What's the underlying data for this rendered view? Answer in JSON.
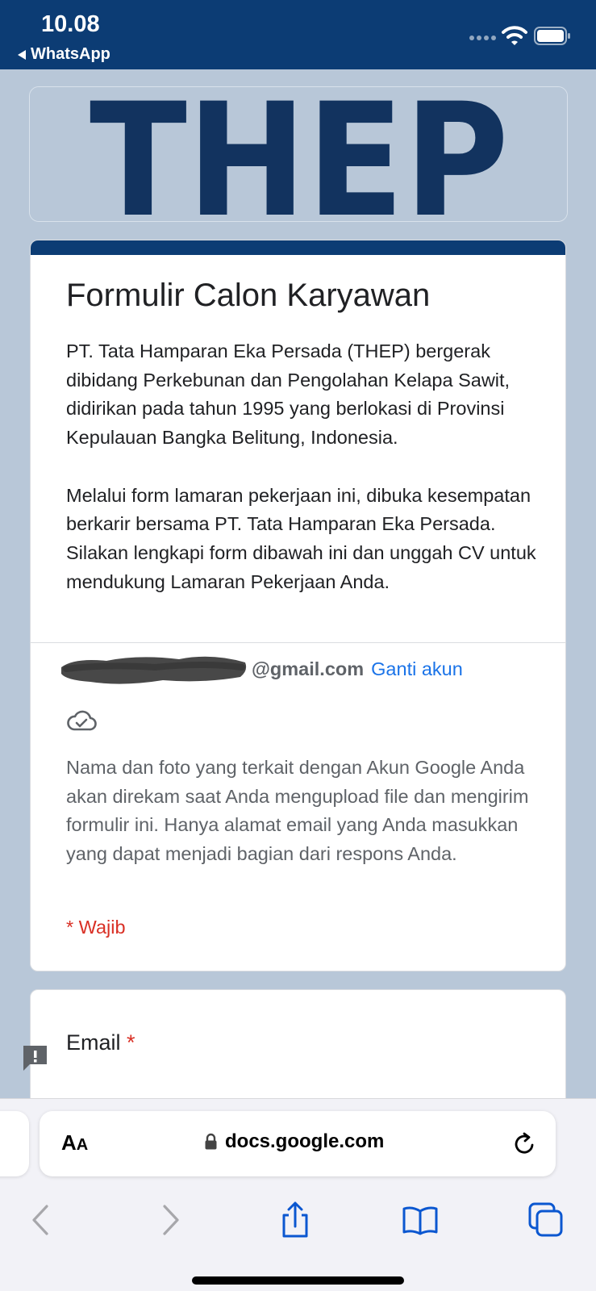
{
  "status_bar": {
    "time": "10.08",
    "back_app": "WhatsApp"
  },
  "banner": {
    "logo_text": "THEP",
    "logo_color": "#12335f"
  },
  "form": {
    "title": "Formulir Calon Karyawan",
    "description": [
      "PT. Tata Hamparan Eka Persada (THEP) bergerak dibidang Perkebunan dan Pengolahan Kelapa Sawit, didirikan pada tahun 1995 yang berlokasi di Provinsi Kepulauan Bangka Belitung, Indonesia.",
      "Melalui form lamaran pekerjaan ini, dibuka kesempatan berkarir bersama PT. Tata Hamparan Eka Persada. Silakan lengkapi form dibawah ini dan unggah CV untuk mendukung Lamaran Pekerjaan Anda."
    ],
    "account_email_suffix": "@gmail.com",
    "switch_account": "Ganti akun",
    "privacy_note": "Nama dan foto yang terkait dengan Akun Google Anda akan direkam saat Anda mengupload file dan mengirim formulir ini. Hanya alamat email yang Anda masukkan yang dapat menjadi bagian dari respons Anda.",
    "required_note": "* Wajib",
    "accent_color": "#0c3c74"
  },
  "question": {
    "title": "Email",
    "required_mark": "*"
  },
  "browser": {
    "aa_large": "A",
    "aa_small": "A",
    "url": "docs.google.com",
    "icons": [
      "back-arrow-icon",
      "forward-arrow-icon",
      "share-icon",
      "bookmarks-icon",
      "tabs-icon",
      "reload-icon",
      "lock-icon"
    ]
  }
}
